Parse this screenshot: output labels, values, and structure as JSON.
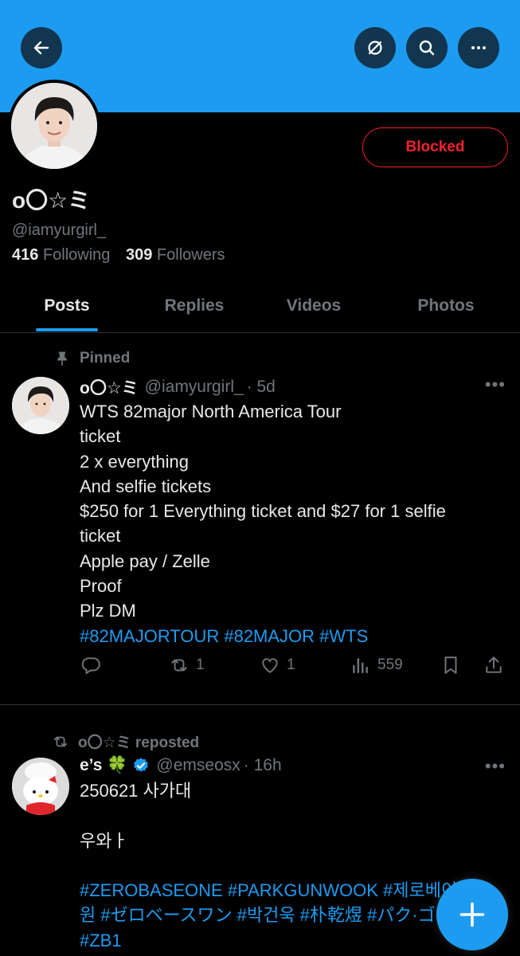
{
  "header": {
    "back_icon": "arrow-left-icon",
    "grok_icon": "slashed-circle-icon",
    "search_icon": "search-icon",
    "more_icon": "more-horizontal-icon",
    "banner_color": "#1d9bf0"
  },
  "profile": {
    "display_name": "o〇☆ミ",
    "handle": "@iamyurgirl_",
    "following_count": "416",
    "following_label": "Following",
    "followers_count": "309",
    "followers_label": "Followers",
    "blocked_label": "Blocked",
    "blocked_color": "#f4212e"
  },
  "tabs": [
    {
      "label": "Posts",
      "active": true
    },
    {
      "label": "Replies",
      "active": false
    },
    {
      "label": "Videos",
      "active": false
    },
    {
      "label": "Photos",
      "active": false
    }
  ],
  "posts": [
    {
      "social_context": "Pinned",
      "social_icon": "pin-icon",
      "author_name": "o〇☆ミ",
      "author_handle": "@iamyurgirl_",
      "time": "· 5d",
      "lines": [
        "WTS 82major North America Tour",
        "ticket",
        "2 x everything",
        "And selfie tickets",
        "$250 for 1 Everything ticket and $27 for 1 selfie",
        "ticket",
        "Apple pay / Zelle",
        "Proof",
        "Plz DM"
      ],
      "hashtags": "#82MAJORTOUR #82MAJOR #WTS",
      "replies": "",
      "reposts": "1",
      "likes": "1",
      "views": "559"
    },
    {
      "social_context": "o〇☆ミ reposted",
      "social_icon": "repost-icon",
      "author_name": "e’s 🍀",
      "verified_icon": "verified-badge-icon",
      "author_handle": "@emseosx",
      "time": "· 16h",
      "lines": [
        "250621 사가대",
        "",
        "우와ㅏ",
        ""
      ],
      "hashtag_lines": [
        "#ZEROBASEONE #PARKGUNWOOK #제로베이스",
        "원 #ゼロベースワン #박건욱 #朴乾煜 #パク·ゴヌク",
        "#ZB1"
      ]
    }
  ],
  "fab": {
    "icon": "plus-icon",
    "color": "#1d9bf0"
  }
}
